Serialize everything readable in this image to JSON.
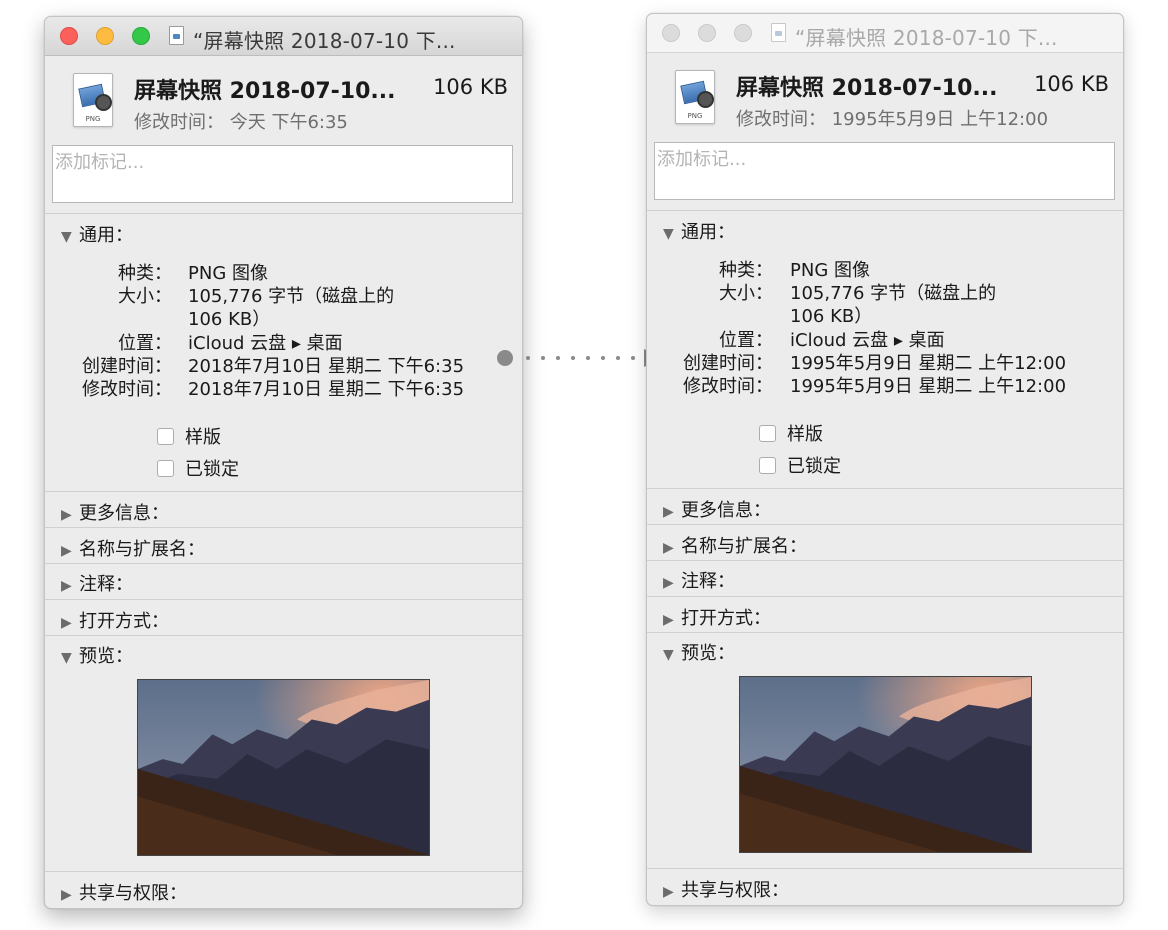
{
  "left": {
    "window_title": "“屏幕快照 2018-07-10 下...",
    "file_icon_ext": "PNG",
    "file_name": "屏幕快照 2018-07-10...",
    "file_size": "106 KB",
    "modified_summary": "修改时间：  今天 下午6:35",
    "tags_placeholder": "添加标记...",
    "general_header": "通用：",
    "general": {
      "kind_label": "种类：",
      "kind_value": "PNG 图像",
      "size_label": "大小：",
      "size_value_line1": "105,776 字节（磁盘上的",
      "size_value_line2": "106 KB）",
      "where_label": "位置：",
      "where_value": "iCloud 云盘 ▸ 桌面",
      "created_label": "创建时间：",
      "created_value": "2018年7月10日 星期二 下午6:35",
      "modified_label": "修改时间：",
      "modified_value": "2018年7月10日 星期二 下午6:35",
      "stationery_label": "样版",
      "locked_label": "已锁定"
    },
    "more_info_header": "更多信息：",
    "name_ext_header": "名称与扩展名：",
    "comments_header": "注释：",
    "open_with_header": "打开方式：",
    "preview_header": "预览：",
    "sharing_header": "共享与权限："
  },
  "right": {
    "window_title": "“屏幕快照 2018-07-10 下...",
    "file_icon_ext": "PNG",
    "file_name": "屏幕快照 2018-07-10...",
    "file_size": "106 KB",
    "modified_summary": "修改时间：  1995年5月9日 上午12:00",
    "tags_placeholder": "添加标记...",
    "general_header": "通用：",
    "general": {
      "kind_label": "种类：",
      "kind_value": "PNG 图像",
      "size_label": "大小：",
      "size_value_line1": "105,776 字节（磁盘上的",
      "size_value_line2": "106 KB）",
      "where_label": "位置：",
      "where_value": "iCloud 云盘 ▸ 桌面",
      "created_label": "创建时间：",
      "created_value": "1995年5月9日 星期二 上午12:00",
      "modified_label": "修改时间：",
      "modified_value": "1995年5月9日 星期二 上午12:00",
      "stationery_label": "样版",
      "locked_label": "已锁定"
    },
    "more_info_header": "更多信息：",
    "name_ext_header": "名称与扩展名：",
    "comments_header": "注释：",
    "open_with_header": "打开方式：",
    "preview_header": "预览：",
    "sharing_header": "共享与权限："
  },
  "icons": {
    "expanded": "▼",
    "collapsed": "▶"
  },
  "colors": {
    "close": "#fc605c",
    "minimize": "#fdbc40",
    "zoom": "#34c84a",
    "connector": "#8a8a8a"
  }
}
